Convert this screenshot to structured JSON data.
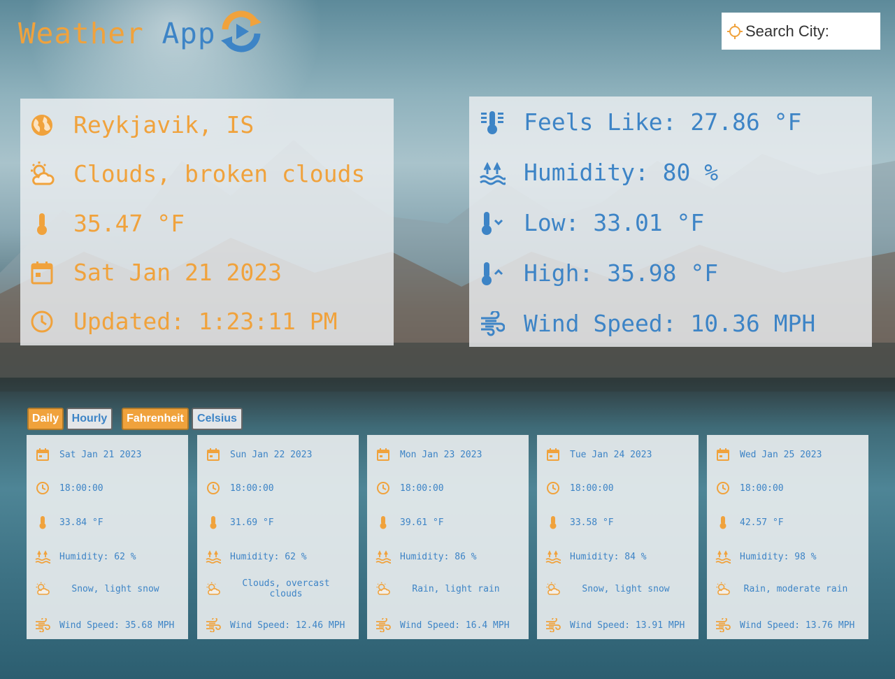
{
  "header": {
    "title_word1": "Weather",
    "title_word2": "App",
    "search_placeholder": "Search City:"
  },
  "colors": {
    "accent": "#f0a23c",
    "primary": "#3d84c6"
  },
  "current": {
    "location": "Reykjavik, IS",
    "condition": "Clouds, broken clouds",
    "temperature": "35.47 °F",
    "date": "Sat Jan 21 2023",
    "updated": "Updated: 1:23:11 PM"
  },
  "details": {
    "feels_like": "Feels Like: 27.86 °F",
    "humidity": "Humidity: 80 %",
    "low": "Low: 33.01 °F",
    "high": "High: 35.98 °F",
    "wind": "Wind Speed: 10.36 MPH"
  },
  "toggles": {
    "daily": "Daily",
    "hourly": "Hourly",
    "fahrenheit": "Fahrenheit",
    "celsius": "Celsius"
  },
  "forecast": [
    {
      "date": "Sat Jan 21 2023",
      "time": "18:00:00",
      "temp": "33.84 °F",
      "humidity": "Humidity: 62 %",
      "desc": "Snow, light snow",
      "wind": "Wind Speed: 35.68 MPH"
    },
    {
      "date": "Sun Jan 22 2023",
      "time": "18:00:00",
      "temp": "31.69 °F",
      "humidity": "Humidity: 62 %",
      "desc": "Clouds, overcast clouds",
      "wind": "Wind Speed: 12.46 MPH"
    },
    {
      "date": "Mon Jan 23 2023",
      "time": "18:00:00",
      "temp": "39.61 °F",
      "humidity": "Humidity: 86 %",
      "desc": "Rain, light rain",
      "wind": "Wind Speed: 16.4 MPH"
    },
    {
      "date": "Tue Jan 24 2023",
      "time": "18:00:00",
      "temp": "33.58 °F",
      "humidity": "Humidity: 84 %",
      "desc": "Snow, light snow",
      "wind": "Wind Speed: 13.91 MPH"
    },
    {
      "date": "Wed Jan 25 2023",
      "time": "18:00:00",
      "temp": "42.57 °F",
      "humidity": "Humidity: 98 %",
      "desc": "Rain, moderate rain",
      "wind": "Wind Speed: 13.76 MPH"
    }
  ]
}
